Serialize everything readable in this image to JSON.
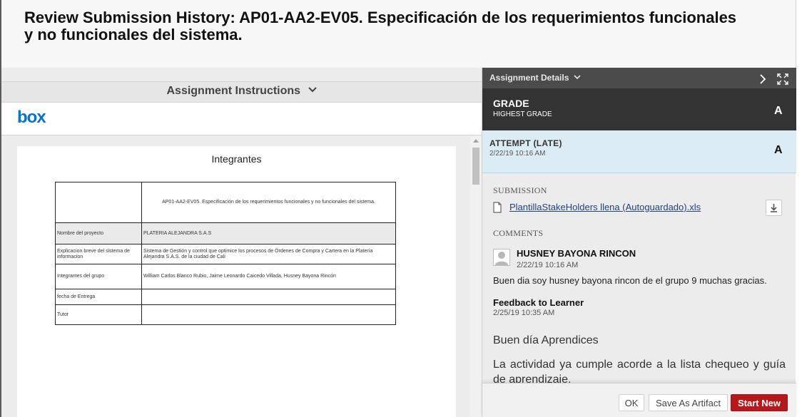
{
  "page": {
    "title": "Review Submission History: AP01-AA2-EV05. Especificación de los requerimientos funcionales y no funcionales del sistema."
  },
  "instructions": {
    "label": "Assignment Instructions",
    "box_logo": "box"
  },
  "document": {
    "heading": "Integrantes",
    "table_header": "AP01-AA2-EV05. Especificación de los requerimientos funcionales y no funcionales del sistema.",
    "rows": [
      {
        "label": "Nombre del proyecto",
        "value": "PLATERIA ALEJANDRA S.A.S"
      },
      {
        "label": "Explicacion breve del sistema de informacion",
        "value": "Sistema de Gestión y control que optimice los procesos de Órdenes de Compra y Cartera en la Platería Alejandra S.A.S. de la ciudad de Cali"
      },
      {
        "label": "Integrantes del grupo",
        "value": "William Carlos Blanco Rubio, Jaime Leonardo Caicedo Villada, Husney Bayona Rincón"
      },
      {
        "label": "fecha de Entrega",
        "value": ""
      },
      {
        "label": "Tutor",
        "value": ""
      }
    ]
  },
  "details": {
    "header_label": "Assignment Details",
    "grade_label": "GRADE",
    "grade_sub": "HIGHEST GRADE",
    "grade_value": "A",
    "attempt_label": "ATTEMPT (LATE)",
    "attempt_date": "2/22/19 10:16 AM",
    "attempt_grade": "A",
    "submission_heading": "SUBMISSION",
    "file_name": "PlantillaStakeHolders llena (Autoguardado).xls",
    "comments_heading": "COMMENTS",
    "commenter_name": "HUSNEY BAYONA RINCON",
    "comment_date": "2/22/19 10:16 AM",
    "comment_text": "Buen dia soy husney bayona rincon de el grupo 9 muchas gracias.",
    "feedback_label": "Feedback to Learner",
    "feedback_date": "2/25/19 10:35 AM",
    "feedback_p1": "Buen día Aprendices",
    "feedback_p2": "La actividad ya cumple acorde a la lista chequeo y guía de aprendizaje."
  },
  "footer": {
    "ok_label": "OK",
    "save_label": "Save As Artifact",
    "start_label": "Start New"
  },
  "colors": {
    "accent_red": "#b7181b",
    "dark_band": "#333333",
    "attempt_band": "#dcecf4",
    "link": "#22427a",
    "box_blue": "#0a72cc"
  }
}
